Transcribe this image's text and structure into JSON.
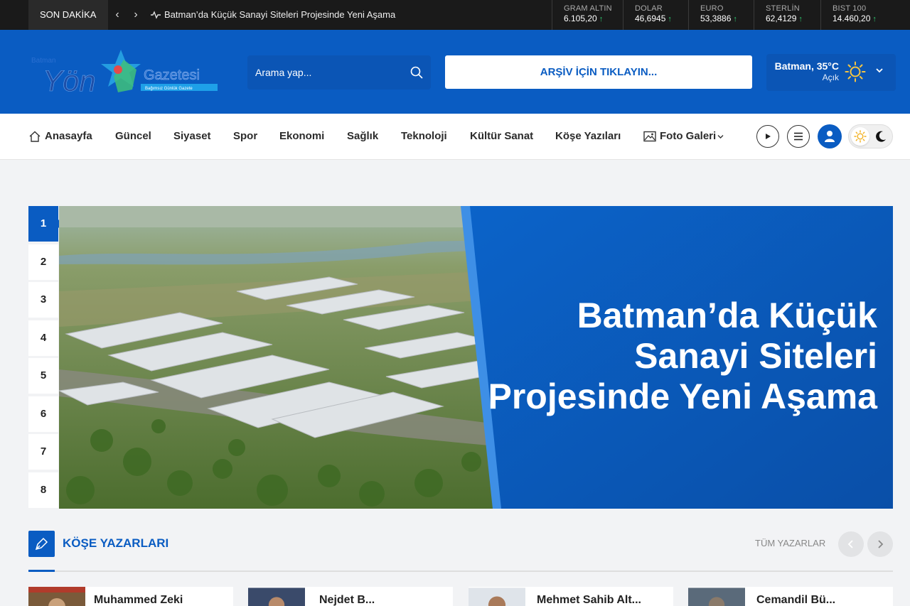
{
  "ticker": {
    "label": "SON DAKİKA",
    "prev": "‹",
    "next": "›",
    "headline": "Batman’da Küçük Sanayi Siteleri Projesinde Yeni Aşama"
  },
  "markets": [
    {
      "label": "GRAM ALTIN",
      "value": "6.105,20",
      "trend": "↑"
    },
    {
      "label": "DOLAR",
      "value": "46,6945",
      "trend": "↑"
    },
    {
      "label": "EURO",
      "value": "53,3886",
      "trend": "↑"
    },
    {
      "label": "STERLİN",
      "value": "62,4129",
      "trend": "↑"
    },
    {
      "label": "BIST 100",
      "value": "14.460,20",
      "trend": "↑"
    }
  ],
  "logo": {
    "small": "Batman",
    "main": "Yön",
    "sub": "Gazetesi",
    "tagline": "Bağımsız Günlük Gazete"
  },
  "search": {
    "placeholder": "Arama yap..."
  },
  "archive": {
    "label": "ARŞİV İÇİN TIKLAYIN..."
  },
  "weather": {
    "city": "Batman, 35°C",
    "condition": "Açık"
  },
  "nav": {
    "items": [
      "Anasayfa",
      "Güncel",
      "Siyaset",
      "Spor",
      "Ekonomi",
      "Sağlık",
      "Teknoloji",
      "Kültür Sanat",
      "Köşe Yazıları",
      "Foto Galeri"
    ]
  },
  "slider": {
    "numbers": [
      "1",
      "2",
      "3",
      "4",
      "5",
      "6",
      "7",
      "8"
    ],
    "active": 1,
    "title": "Batman’da Küçük Sanayi Siteleri Projesinde Yeni Aşama"
  },
  "columnists": {
    "title": "KÖŞE YAZARLARI",
    "all_label": "TÜM YAZARLAR",
    "writers": [
      "Muhammed Zeki",
      "Nejdet B...",
      "Mehmet Sahib Alt...",
      "Cemandil Bü..."
    ]
  },
  "colors": {
    "brand": "#0a5cc2",
    "topbar": "#1a1a1a",
    "up": "#2ecc71"
  }
}
